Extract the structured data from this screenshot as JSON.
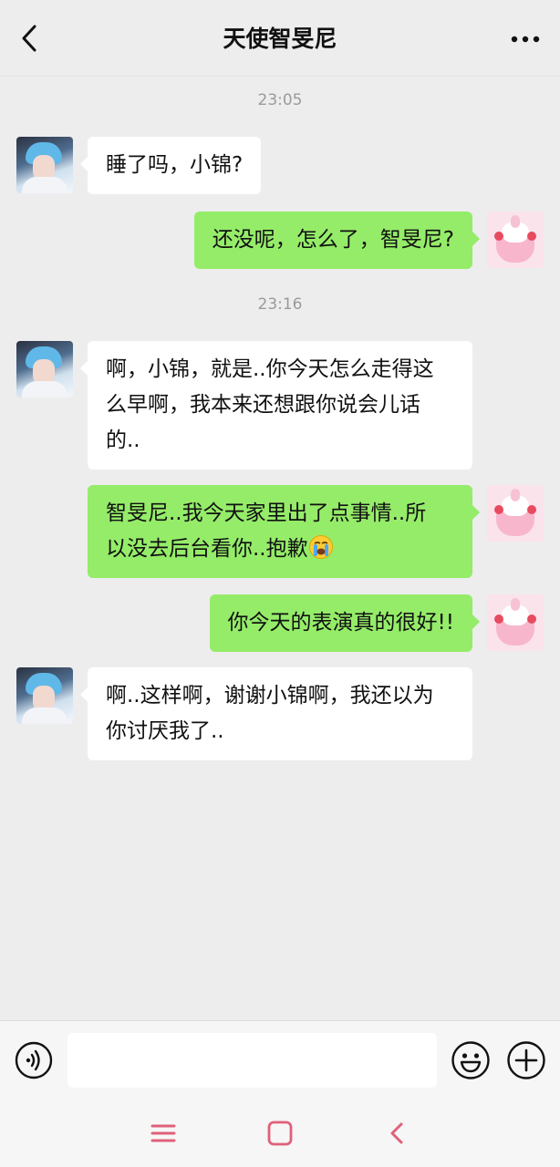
{
  "header": {
    "title": "天使智旻尼",
    "back_icon": "chevron-left-icon",
    "more_icon": "more-dots-icon"
  },
  "messages": [
    {
      "type": "time",
      "text": "23:05"
    },
    {
      "type": "in",
      "lines": [
        "睡了吗，小锦?"
      ]
    },
    {
      "type": "out",
      "lines": [
        "还没呢，怎么了，智旻尼?"
      ]
    },
    {
      "type": "time",
      "text": "23:16"
    },
    {
      "type": "in",
      "lines": [
        "啊，小锦，就是..你今天怎么走得这",
        "么早啊，我本来还想跟你说会儿话",
        "的.."
      ]
    },
    {
      "type": "out",
      "lines": [
        "智旻尼..我今天家里出了点事情..所",
        "以没去后台看你..抱歉"
      ],
      "emoji": "loudly-crying-face"
    },
    {
      "type": "out",
      "lines": [
        "你今天的表演真的很好!!"
      ]
    },
    {
      "type": "in",
      "lines": [
        "啊..这样啊，谢谢小锦啊，我还以为",
        "你讨厌我了.."
      ]
    }
  ],
  "input_bar": {
    "voice_icon": "voice-icon",
    "input_value": "",
    "emoji_icon": "smiley-icon",
    "plus_icon": "plus-circle-icon"
  },
  "system_nav": {
    "menu_icon": "menu-icon",
    "home_icon": "home-square-icon",
    "back_icon": "back-chevron-icon"
  },
  "colors": {
    "background": "#ededed",
    "outgoing_bubble": "#95ec69",
    "incoming_bubble": "#ffffff",
    "nav_icon": "#e0607a"
  }
}
